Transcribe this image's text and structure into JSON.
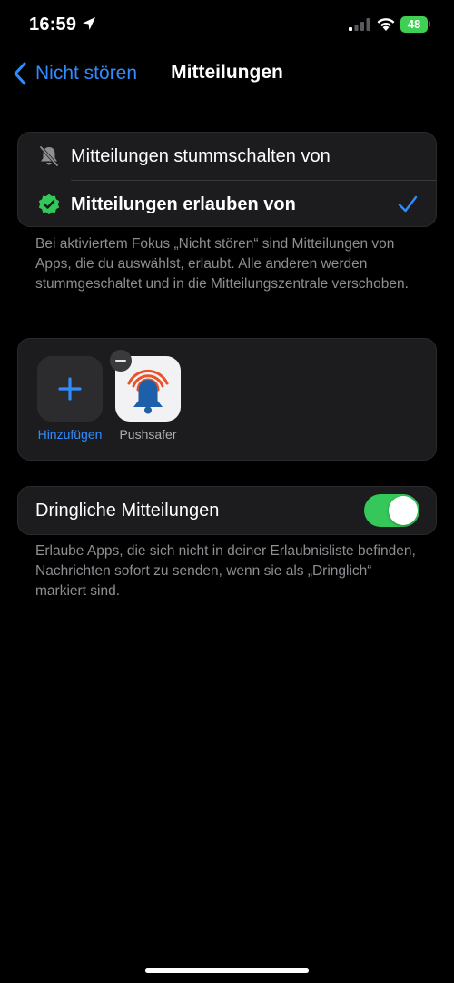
{
  "status_bar": {
    "time": "16:59",
    "battery_level": "48"
  },
  "nav": {
    "back_label": "Nicht stören",
    "title": "Mitteilungen"
  },
  "mode_options": {
    "items": [
      {
        "label": "Mitteilungen stummschalten von",
        "icon": "bell-slash-icon",
        "selected": false
      },
      {
        "label": "Mitteilungen erlauben von",
        "icon": "checkmark-seal-icon",
        "selected": true
      }
    ]
  },
  "mode_footnote": "Bei aktiviertem Fokus „Nicht stören“ sind Mitteilungen von Apps, die du auswählst, erlaubt. Alle anderen werden stummgeschaltet und in die Mitteilungszentrale verschoben.",
  "apps": {
    "add_label": "Hinzufügen",
    "items": [
      {
        "name": "Pushsafer",
        "icon": "pushsafer-bell-icon"
      }
    ]
  },
  "urgent": {
    "label": "Dringliche Mitteilungen",
    "enabled": true,
    "footnote": "Erlaube Apps, die sich nicht in deiner Erlaubnisliste befinden, Nachrichten sofort zu senden, wenn sie als „Dringlich“ markiert sind."
  },
  "colors": {
    "accent": "#2f8cff",
    "toggle_on": "#35c759",
    "battery": "#3ecf53",
    "check_badge": "#34c759",
    "pushsafer_bell": "#1d5fa8",
    "pushsafer_waves": "#e8532b"
  }
}
